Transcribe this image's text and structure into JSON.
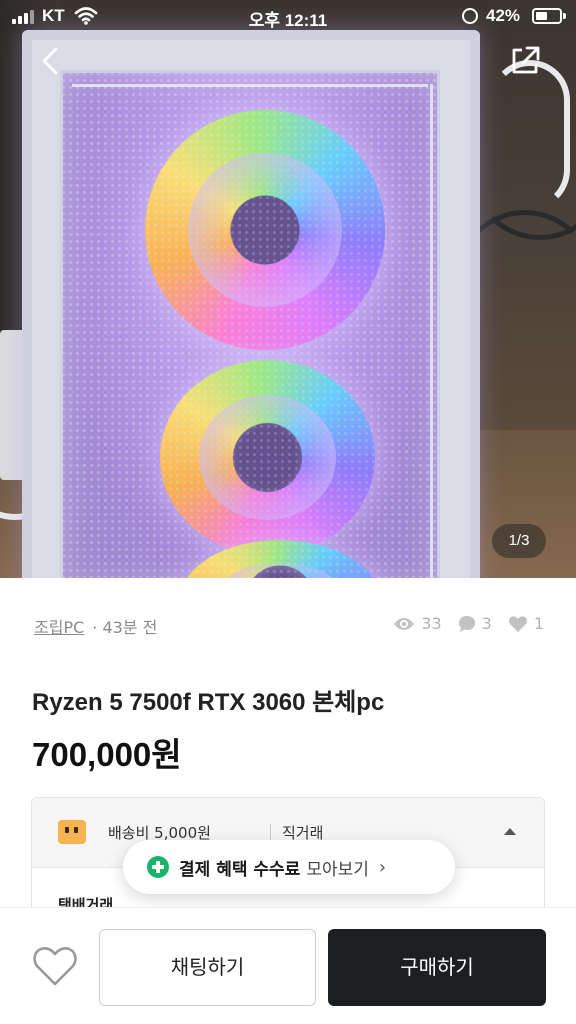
{
  "status_bar": {
    "carrier": "KT",
    "time": "오후 12:11",
    "battery": "42%"
  },
  "photo": {
    "counter": "1/3"
  },
  "product": {
    "category": "조립PC",
    "posted": "· 43분 전",
    "views": "33",
    "chats": "3",
    "likes": "1",
    "title": "Ryzen 5 7500f RTX 3060 본체pc",
    "price": "700,000원"
  },
  "shipping": {
    "fee": "배송비 5,000원",
    "method": "직거래",
    "next_label": "택배거래"
  },
  "benefit_banner": {
    "bold": "결제 혜택 수수료",
    "rest": "모아보기"
  },
  "actions": {
    "chat": "채팅하기",
    "buy": "구매하기"
  },
  "colors": {
    "buy_bg": "#1c1f22",
    "benefit_icon": "#19b46a",
    "shipping_icon": "#f5b352"
  }
}
